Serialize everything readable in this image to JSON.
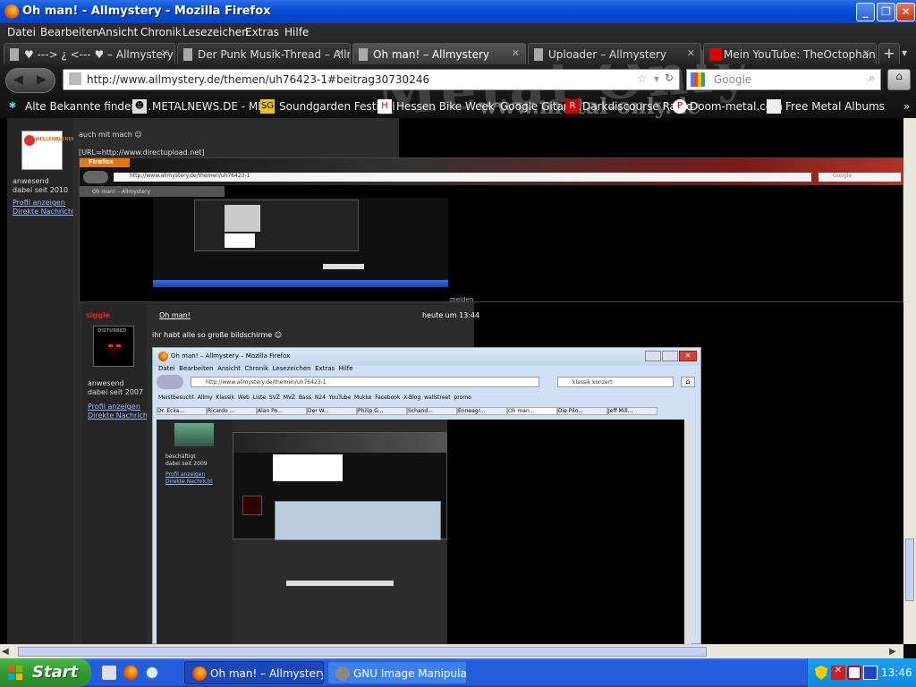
{
  "window": {
    "title": "Oh man! - Allmystery - Mozilla Firefox"
  },
  "menu": [
    "Datei",
    "Bearbeiten",
    "Ansicht",
    "Chronik",
    "Lesezeichen",
    "Extras",
    "Hilfe"
  ],
  "tabs": [
    {
      "label": "♥ ---> ¿ <--- ♥ – Allmystery",
      "active": false
    },
    {
      "label": "Der Punk Musik-Thread – Allm...",
      "active": false
    },
    {
      "label": "Oh man! – Allmystery",
      "active": true
    },
    {
      "label": "Uploader – Allmystery",
      "active": false
    },
    {
      "label": "Mein YouTube: TheOctophant...",
      "active": false
    }
  ],
  "nav": {
    "url": "http://www.allmystery.de/themen/uh76423-1#beitrag30730246",
    "search_placeholder": "Google"
  },
  "bookmarks": [
    "Alte Bekannte finden ...",
    "METALNEWS.DE - ME...",
    "Soundgarden Festival",
    "Hessen Bike Week",
    "Google Gitarr...",
    "Darkdiscourse Radio",
    "Doom-metal.com",
    "Free Metal Albums"
  ],
  "bookmark_icons": {
    "sg": "SG",
    "h": "H",
    "p": "P"
  },
  "banner": {
    "line1": "Metal Only",
    "line2": "www.metal-only.de"
  },
  "post1": {
    "status": "anwesend",
    "since": "dabei seit 2010",
    "profile": "Profil anzeigen",
    "message": "Direkte Nachricht",
    "text1": "auch mit mach ☺",
    "text2": "[URL=http://www.directupload.net]",
    "report": "melden",
    "logo": "WELLENBLENDE"
  },
  "embed1": {
    "menu_label": "Firefox",
    "url": "http://www.allmystery.de/themen/uh76423-1",
    "search": "Google",
    "tab": "Oh man! – Allmystery"
  },
  "post2": {
    "user": "siggie",
    "title": "Oh man!",
    "time": "heute um 13:44",
    "text": "ihr habt alle so große bildschirme ☺",
    "status": "anwesend",
    "since": "dabei seit 2007",
    "profile": "Profil anzeigen",
    "message": "Direkte Nachricht",
    "avatar_label": "DISTURBED"
  },
  "embed2": {
    "title": "Oh man! – Allmystery – Mozilla Firefox",
    "menu": [
      "Datei",
      "Bearbeiten",
      "Ansicht",
      "Chronik",
      "Lesezeichen",
      "Extras",
      "Hilfe"
    ],
    "url": "http://www.allmystery.de/themen/uh76423-1",
    "search": "klassik konzert",
    "bookmarks": [
      "Meistbesucht",
      "Allmy",
      "Klassik",
      "Web",
      "Liste",
      "SVZ",
      "MVZ",
      "Bass",
      "N24",
      "YouTube",
      "Mukke",
      "Facebook",
      "X-Blog",
      "wallstreet",
      "promo"
    ],
    "tabs": [
      "Dr. Ecka...",
      "Ricardo ...",
      "Alan Po...",
      "Der W...",
      "Philip G...",
      "Schand...",
      "Enneagr...",
      "Oh man...",
      "Die Pilo...",
      "Jeff Mill..."
    ],
    "status": "beschäftigt",
    "since": "dabei seit 2009",
    "profile": "Profil anzeigen",
    "message": "Direkte Nachricht"
  },
  "taskbar": {
    "start": "Start",
    "items": [
      {
        "label": "Oh man! – Allmystery...",
        "active": true
      },
      {
        "label": "GNU Image Manipulat...",
        "active": false
      }
    ],
    "clock": "13:46"
  }
}
